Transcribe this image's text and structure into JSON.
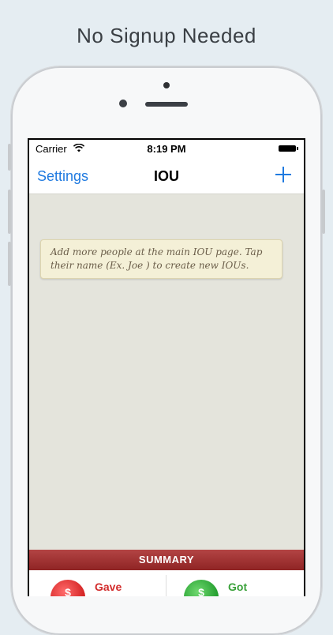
{
  "headline": "No Signup Needed",
  "status_bar": {
    "carrier": "Carrier",
    "time": "8:19 PM"
  },
  "nav": {
    "left_label": "Settings",
    "title": "IOU",
    "add_icon": "plus-icon"
  },
  "hint_text": "Add more people at the main IOU page. Tap their name (Ex. Joe ) to create new IOUs.",
  "summary": {
    "header": "SUMMARY",
    "gave_label": "Gave",
    "got_label": "Got",
    "gave_symbol": "$",
    "got_symbol": "$"
  },
  "colors": {
    "accent": "#1f7ae0",
    "summary_bar": "#a33333",
    "gave": "#d22b2b",
    "got": "#3aa13a"
  }
}
